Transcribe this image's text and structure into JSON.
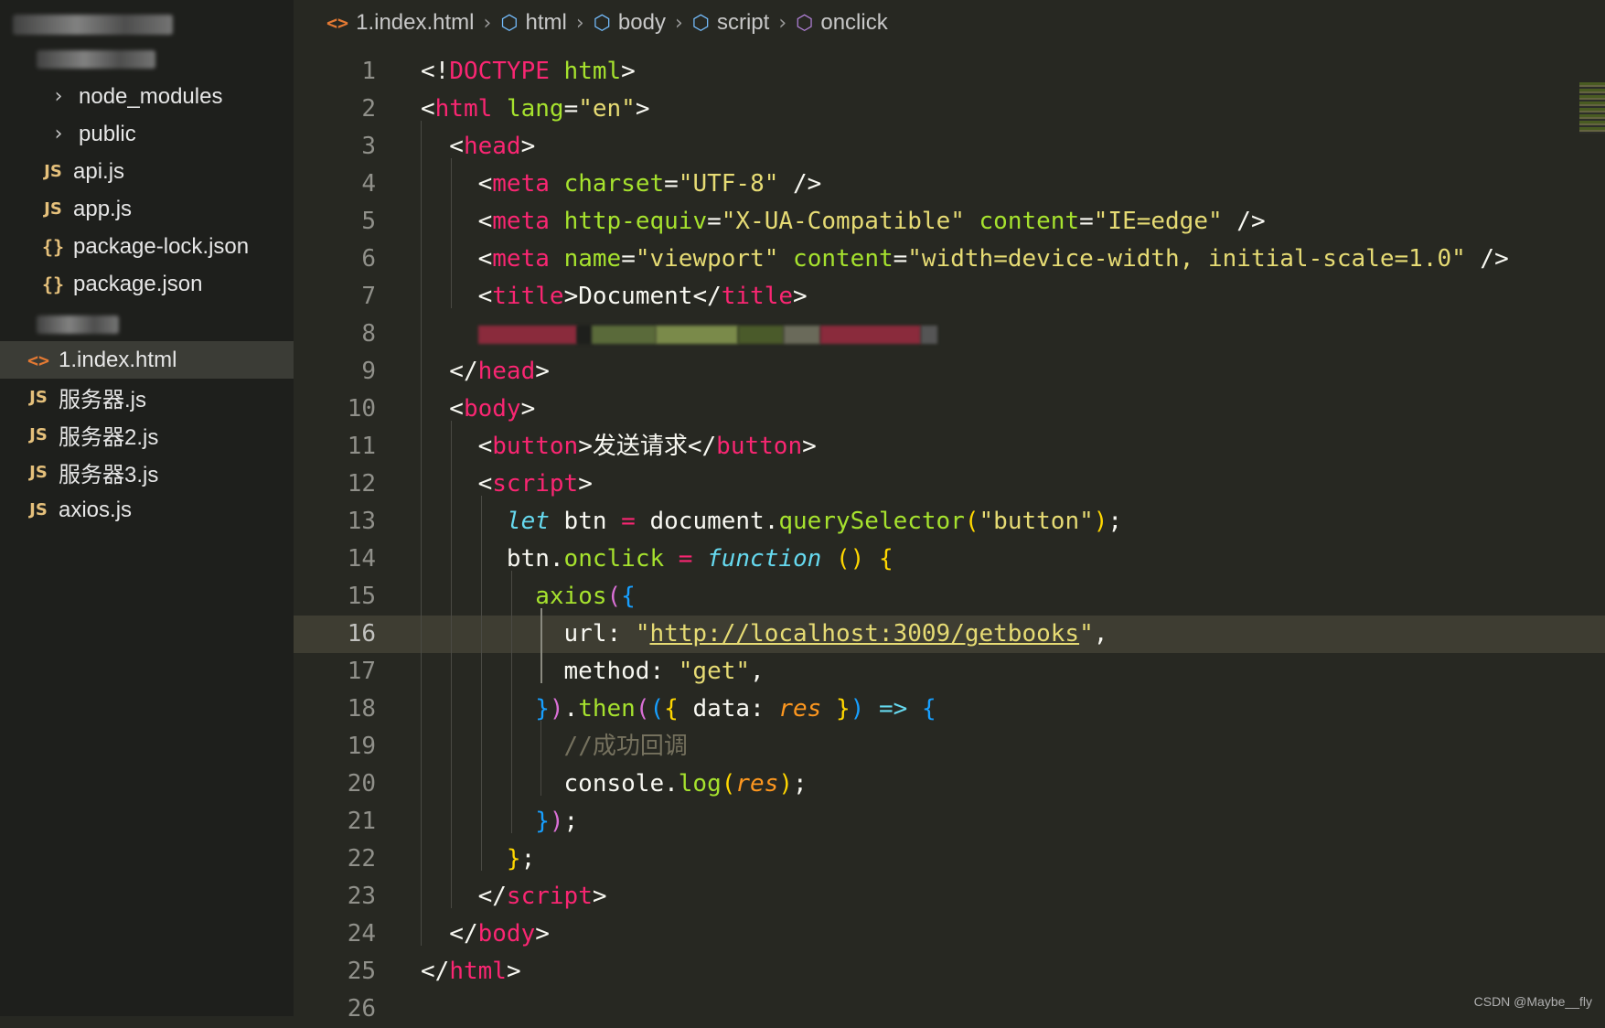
{
  "sidebar": {
    "items": [
      {
        "icon": "chevron-right-icon",
        "label": "node_modules",
        "type": "folder"
      },
      {
        "icon": "chevron-right-icon",
        "label": "public",
        "type": "folder"
      },
      {
        "icon": "js-file-icon",
        "label": "api.js",
        "type": "js"
      },
      {
        "icon": "js-file-icon",
        "label": "app.js",
        "type": "js"
      },
      {
        "icon": "json-file-icon",
        "label": "package-lock.json",
        "type": "json"
      },
      {
        "icon": "json-file-icon",
        "label": "package.json",
        "type": "json"
      },
      {
        "icon": "html-file-icon",
        "label": "1.index.html",
        "type": "html",
        "selected": true
      },
      {
        "icon": "js-file-icon",
        "label": "服务器.js",
        "type": "js"
      },
      {
        "icon": "js-file-icon",
        "label": "服务器2.js",
        "type": "js"
      },
      {
        "icon": "js-file-icon",
        "label": "服务器3.js",
        "type": "js"
      },
      {
        "icon": "js-file-icon",
        "label": "axios.js",
        "type": "js"
      }
    ],
    "icon_glyphs": {
      "js": "JS",
      "json": "{}",
      "html": "<>",
      "folder": "›"
    }
  },
  "breadcrumb": {
    "file": "1.index.html",
    "path": [
      "html",
      "body",
      "script",
      "onclick"
    ]
  },
  "editor": {
    "current_line": 16,
    "lines": [
      {
        "n": "1",
        "tokens": [
          [
            "t-punc",
            "<!"
          ],
          [
            "t-tag",
            "DOCTYPE"
          ],
          [
            "t-punc",
            " "
          ],
          [
            "t-attr",
            "html"
          ],
          [
            "t-punc",
            ">"
          ]
        ]
      },
      {
        "n": "2",
        "tokens": [
          [
            "t-punc",
            "<"
          ],
          [
            "t-tag",
            "html"
          ],
          [
            "t-punc",
            " "
          ],
          [
            "t-attr",
            "lang"
          ],
          [
            "t-punc",
            "="
          ],
          [
            "t-str",
            "\"en\""
          ],
          [
            "t-punc",
            ">"
          ]
        ]
      },
      {
        "n": "3",
        "tokens": [
          [
            "t-punc",
            "  <"
          ],
          [
            "t-tag",
            "head"
          ],
          [
            "t-punc",
            ">"
          ]
        ]
      },
      {
        "n": "4",
        "tokens": [
          [
            "t-punc",
            "    <"
          ],
          [
            "t-tag",
            "meta"
          ],
          [
            "t-punc",
            " "
          ],
          [
            "t-attr",
            "charset"
          ],
          [
            "t-punc",
            "="
          ],
          [
            "t-str",
            "\"UTF-8\""
          ],
          [
            "t-punc",
            " />"
          ]
        ]
      },
      {
        "n": "5",
        "tokens": [
          [
            "t-punc",
            "    <"
          ],
          [
            "t-tag",
            "meta"
          ],
          [
            "t-punc",
            " "
          ],
          [
            "t-attr",
            "http-equiv"
          ],
          [
            "t-punc",
            "="
          ],
          [
            "t-str",
            "\"X-UA-Compatible\""
          ],
          [
            "t-punc",
            " "
          ],
          [
            "t-attr",
            "content"
          ],
          [
            "t-punc",
            "="
          ],
          [
            "t-str",
            "\"IE=edge\""
          ],
          [
            "t-punc",
            " />"
          ]
        ]
      },
      {
        "n": "6",
        "tokens": [
          [
            "t-punc",
            "    <"
          ],
          [
            "t-tag",
            "meta"
          ],
          [
            "t-punc",
            " "
          ],
          [
            "t-attr",
            "name"
          ],
          [
            "t-punc",
            "="
          ],
          [
            "t-str",
            "\"viewport\""
          ],
          [
            "t-punc",
            " "
          ],
          [
            "t-attr",
            "content"
          ],
          [
            "t-punc",
            "="
          ],
          [
            "t-str",
            "\"width=device-width, initial-scale=1.0\""
          ],
          [
            "t-punc",
            " />"
          ]
        ]
      },
      {
        "n": "7",
        "tokens": [
          [
            "t-punc",
            "    <"
          ],
          [
            "t-tag",
            "title"
          ],
          [
            "t-punc",
            ">Document</"
          ],
          [
            "t-tag",
            "title"
          ],
          [
            "t-punc",
            ">"
          ]
        ]
      },
      {
        "n": "8",
        "tokens": [
          [
            "redacted",
            "    "
          ]
        ]
      },
      {
        "n": "9",
        "tokens": [
          [
            "t-punc",
            "  </"
          ],
          [
            "t-tag",
            "head"
          ],
          [
            "t-punc",
            ">"
          ]
        ]
      },
      {
        "n": "10",
        "tokens": [
          [
            "t-punc",
            "  <"
          ],
          [
            "t-tag",
            "body"
          ],
          [
            "t-punc",
            ">"
          ]
        ]
      },
      {
        "n": "11",
        "tokens": [
          [
            "t-punc",
            "    <"
          ],
          [
            "t-tag",
            "button"
          ],
          [
            "t-punc",
            ">发送请求</"
          ],
          [
            "t-tag",
            "button"
          ],
          [
            "t-punc",
            ">"
          ]
        ]
      },
      {
        "n": "12",
        "tokens": [
          [
            "t-punc",
            "    <"
          ],
          [
            "t-tag",
            "script"
          ],
          [
            "t-punc",
            ">"
          ]
        ]
      },
      {
        "n": "13",
        "tokens": [
          [
            "t-punc",
            "      "
          ],
          [
            "t-kw",
            "let"
          ],
          [
            "t-punc",
            " btn "
          ],
          [
            "t-op",
            "="
          ],
          [
            "t-punc",
            " document."
          ],
          [
            "t-fn",
            "querySelector"
          ],
          [
            "t-b1",
            "("
          ],
          [
            "t-str",
            "\"button\""
          ],
          [
            "t-b1",
            ")"
          ],
          [
            "t-punc",
            ";"
          ]
        ]
      },
      {
        "n": "14",
        "tokens": [
          [
            "t-punc",
            "      btn."
          ],
          [
            "t-fn",
            "onclick"
          ],
          [
            "t-punc",
            " "
          ],
          [
            "t-op",
            "="
          ],
          [
            "t-punc",
            " "
          ],
          [
            "t-kw",
            "function"
          ],
          [
            "t-punc",
            " "
          ],
          [
            "t-b1",
            "()"
          ],
          [
            "t-punc",
            " "
          ],
          [
            "t-b1",
            "{"
          ]
        ]
      },
      {
        "n": "15",
        "tokens": [
          [
            "t-punc",
            "        "
          ],
          [
            "t-fn",
            "axios"
          ],
          [
            "t-b2",
            "("
          ],
          [
            "t-b3",
            "{"
          ]
        ]
      },
      {
        "n": "16",
        "tokens": [
          [
            "t-punc",
            "          url: "
          ],
          [
            "t-str",
            "\""
          ],
          [
            "t-link",
            "http://localhost:3009/getbooks"
          ],
          [
            "t-str",
            "\""
          ],
          [
            "t-punc",
            ","
          ]
        ]
      },
      {
        "n": "17",
        "tokens": [
          [
            "t-punc",
            "          method: "
          ],
          [
            "t-str",
            "\"get\""
          ],
          [
            "t-punc",
            ","
          ]
        ]
      },
      {
        "n": "18",
        "tokens": [
          [
            "t-punc",
            "        "
          ],
          [
            "t-b3",
            "}"
          ],
          [
            "t-b2",
            ")"
          ],
          [
            "t-punc",
            "."
          ],
          [
            "t-fn",
            "then"
          ],
          [
            "t-b2",
            "("
          ],
          [
            "t-b3",
            "("
          ],
          [
            "t-b1",
            "{"
          ],
          [
            "t-punc",
            " data: "
          ],
          [
            "t-param",
            "res"
          ],
          [
            "t-punc",
            " "
          ],
          [
            "t-b1",
            "}"
          ],
          [
            "t-b3",
            ")"
          ],
          [
            "t-punc",
            " "
          ],
          [
            "t-kw",
            "=>"
          ],
          [
            "t-punc",
            " "
          ],
          [
            "t-b3",
            "{"
          ]
        ]
      },
      {
        "n": "19",
        "tokens": [
          [
            "t-punc",
            "          "
          ],
          [
            "t-comment",
            "//成功回调"
          ]
        ]
      },
      {
        "n": "20",
        "tokens": [
          [
            "t-punc",
            "          console."
          ],
          [
            "t-fn",
            "log"
          ],
          [
            "t-b1",
            "("
          ],
          [
            "t-param",
            "res"
          ],
          [
            "t-b1",
            ")"
          ],
          [
            "t-punc",
            ";"
          ]
        ]
      },
      {
        "n": "21",
        "tokens": [
          [
            "t-punc",
            "        "
          ],
          [
            "t-b3",
            "}"
          ],
          [
            "t-b2",
            ")"
          ],
          [
            "t-punc",
            ";"
          ]
        ]
      },
      {
        "n": "22",
        "tokens": [
          [
            "t-punc",
            "      "
          ],
          [
            "t-b1",
            "}"
          ],
          [
            "t-punc",
            ";"
          ]
        ]
      },
      {
        "n": "23",
        "tokens": [
          [
            "t-punc",
            "    </"
          ],
          [
            "t-tag",
            "script"
          ],
          [
            "t-punc",
            ">"
          ]
        ]
      },
      {
        "n": "24",
        "tokens": [
          [
            "t-punc",
            "  </"
          ],
          [
            "t-tag",
            "body"
          ],
          [
            "t-punc",
            ">"
          ]
        ]
      },
      {
        "n": "25",
        "tokens": [
          [
            "t-punc",
            "</"
          ],
          [
            "t-tag",
            "html"
          ],
          [
            "t-punc",
            ">"
          ]
        ]
      },
      {
        "n": "26",
        "tokens": []
      }
    ]
  },
  "watermark": "CSDN @Maybe__fly"
}
